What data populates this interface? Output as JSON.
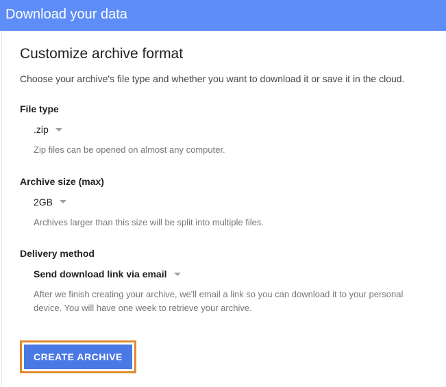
{
  "header": {
    "title": "Download your data"
  },
  "section": {
    "title": "Customize archive format",
    "description": "Choose your archive's file type and whether you want to download it or save it in the cloud."
  },
  "fields": {
    "fileType": {
      "label": "File type",
      "value": ".zip",
      "hint": "Zip files can be opened on almost any computer."
    },
    "archiveSize": {
      "label": "Archive size (max)",
      "value": "2GB",
      "hint": "Archives larger than this size will be split into multiple files."
    },
    "deliveryMethod": {
      "label": "Delivery method",
      "value": "Send download link via email",
      "hint": "After we finish creating your archive, we'll email a link so you can download it to your personal device. You will have one week to retrieve your archive."
    }
  },
  "button": {
    "createArchive": "CREATE ARCHIVE"
  }
}
